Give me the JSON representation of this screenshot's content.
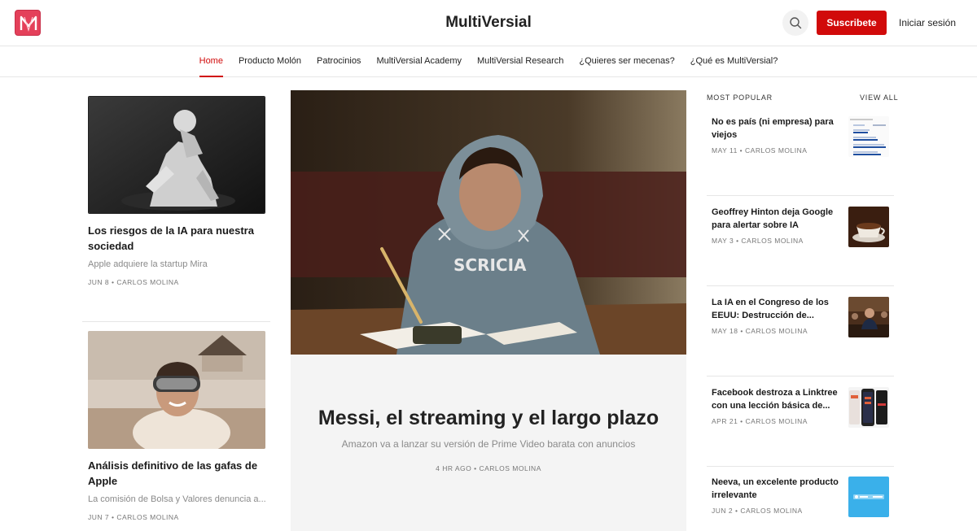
{
  "header": {
    "logo_letter": "M",
    "title": "MultiVersial",
    "subscribe_label": "Suscribete",
    "login_label": "Iniciar sesión",
    "accent": "#d10a0a"
  },
  "nav": {
    "items": [
      "Home",
      "Producto Molón",
      "Patrocinios",
      "MultiVersial Academy",
      "MultiVersial Research",
      "¿Quieres ser mecenas?",
      "¿Qué es MultiVersial?"
    ]
  },
  "left_posts": [
    {
      "title": "Los riesgos de la IA para nuestra sociedad",
      "subtitle": "Apple adquiere la startup Mira",
      "meta": "JUN 8 • CARLOS MOLINA"
    },
    {
      "title": "Análisis definitivo de las gafas de Apple",
      "subtitle": "La comisión de Bolsa y Valores denuncia a...",
      "meta": "JUN 7 • CARLOS MOLINA"
    }
  ],
  "hero": {
    "title": "Messi, el streaming y el largo plazo",
    "subtitle": "Amazon va a lanzar su versión de Prime Video barata con anuncios",
    "meta": "4 HR AGO • CARLOS MOLINA"
  },
  "sidebar": {
    "heading": "MOST POPULAR",
    "view_all": "VIEW ALL",
    "items": [
      {
        "title": "No es país (ni empresa) para viejos",
        "meta": "MAY 11 • CARLOS MOLINA"
      },
      {
        "title": "Geoffrey Hinton deja Google para alertar sobre IA",
        "meta": "MAY 3 • CARLOS MOLINA"
      },
      {
        "title": "La IA en el Congreso de los EEUU: Destrucción de...",
        "meta": "MAY 18 • CARLOS MOLINA"
      },
      {
        "title": "Facebook destroza a Linktree con una lección básica de...",
        "meta": "APR 21 • CARLOS MOLINA"
      },
      {
        "title": "Neeva, un excelente producto irrelevante",
        "meta": "JUN 2 • CARLOS MOLINA"
      }
    ]
  }
}
